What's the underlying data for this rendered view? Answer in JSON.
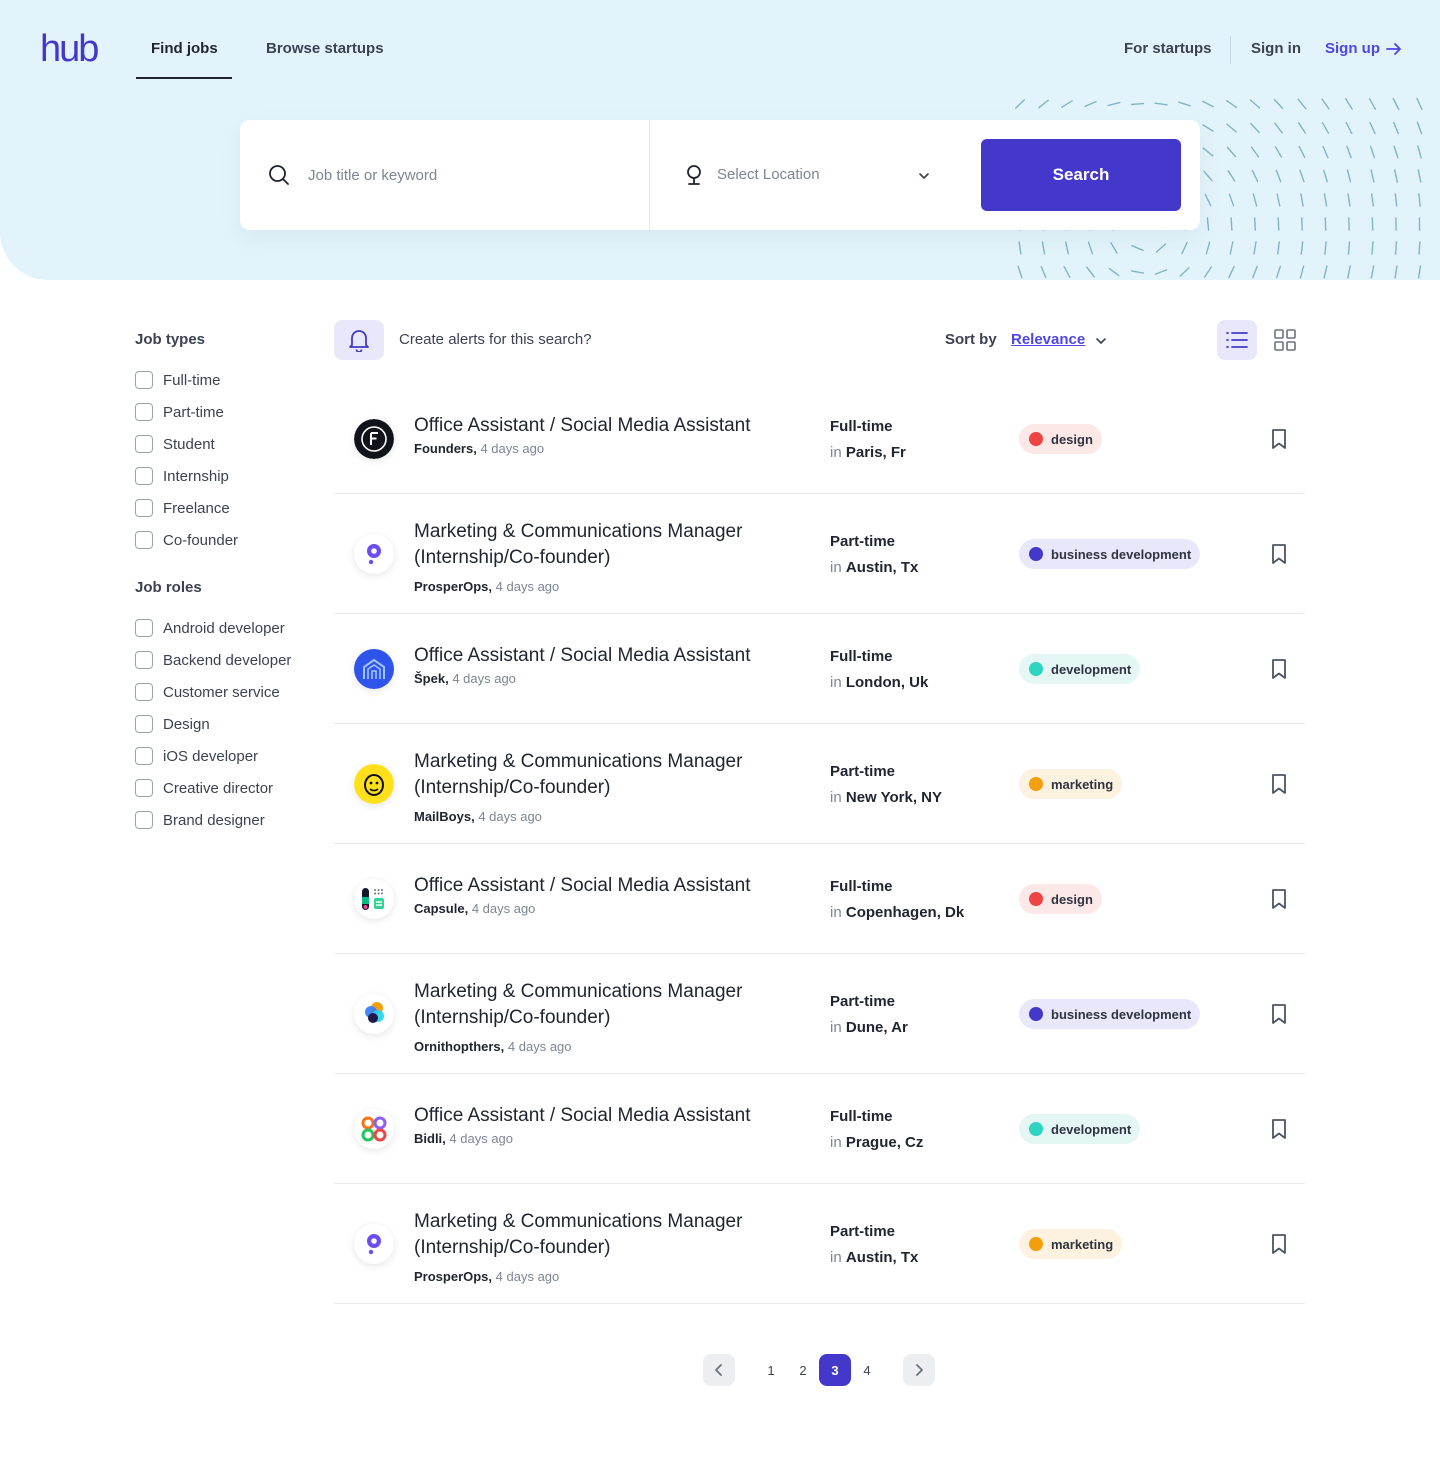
{
  "brand": {
    "logo_text": "hub",
    "accent_color": "#4338ca"
  },
  "nav": {
    "find_jobs": "Find jobs",
    "browse_startups": "Browse startups",
    "for_startups": "For startups",
    "sign_in": "Sign in",
    "sign_up": "Sign up"
  },
  "search": {
    "keyword_placeholder": "Job title or keyword",
    "location_placeholder": "Select Location",
    "button_label": "Search"
  },
  "filters": {
    "job_types_heading": "Job types",
    "job_types": [
      "Full-time",
      "Part-time",
      "Student",
      "Internship",
      "Freelance",
      "Co-founder"
    ],
    "job_roles_heading": "Job roles",
    "job_roles": [
      "Android developer",
      "Backend developer",
      "Customer service",
      "Design",
      "iOS developer",
      "Creative director",
      "Brand designer"
    ]
  },
  "toolbar": {
    "alert_text": "Create alerts for this search?",
    "sort_label": "Sort by",
    "sort_value": "Relevance"
  },
  "tag_colors": {
    "design": {
      "dot": "#ef4444",
      "bg": "#fde8e8"
    },
    "business development": {
      "dot": "#4338ca",
      "bg": "#e9e8fb"
    },
    "development": {
      "dot": "#2dd4bf",
      "bg": "#e4f7f5"
    },
    "marketing": {
      "dot": "#f59e0b",
      "bg": "#fdf1df"
    }
  },
  "jobs": [
    {
      "title": "Office Assistant / Social Media Assistant",
      "company": "Founders,",
      "posted": "4 days ago",
      "type": "Full-time",
      "location": "Paris, Fr",
      "tag": "design",
      "logo_icon": "founders-logo-icon"
    },
    {
      "title": "Marketing & Communications Manager (Internship/Co-founder)",
      "company": "ProsperOps,",
      "posted": "4 days ago",
      "type": "Part-time",
      "location": "Austin, Tx",
      "tag": "business development",
      "logo_icon": "prosperops-logo-icon"
    },
    {
      "title": "Office Assistant / Social Media Assistant",
      "company": "Špek,",
      "posted": "4 days ago",
      "type": "Full-time",
      "location": "London, Uk",
      "tag": "development",
      "logo_icon": "spek-logo-icon"
    },
    {
      "title": "Marketing & Communications Manager (Internship/Co-founder)",
      "company": "MailBoys,",
      "posted": "4 days ago",
      "type": "Part-time",
      "location": "New York, NY",
      "tag": "marketing",
      "logo_icon": "mailboys-logo-icon"
    },
    {
      "title": "Office Assistant / Social Media Assistant",
      "company": "Capsule,",
      "posted": "4 days ago",
      "type": "Full-time",
      "location": "Copenhagen, Dk",
      "tag": "design",
      "logo_icon": "capsule-logo-icon"
    },
    {
      "title": "Marketing & Communications Manager (Internship/Co-founder)",
      "company": "Ornithopthers,",
      "posted": "4 days ago",
      "type": "Part-time",
      "location": "Dune, Ar",
      "tag": "business development",
      "logo_icon": "ornithopthers-logo-icon"
    },
    {
      "title": "Office Assistant / Social Media Assistant",
      "company": "Bidli,",
      "posted": "4 days ago",
      "type": "Full-time",
      "location": "Prague, Cz",
      "tag": "development",
      "logo_icon": "bidli-logo-icon"
    },
    {
      "title": "Marketing & Communications Manager (Internship/Co-founder)",
      "company": "ProsperOps,",
      "posted": "4 days ago",
      "type": "Part-time",
      "location": "Austin, Tx",
      "tag": "marketing",
      "logo_icon": "prosperops-logo-icon"
    }
  ],
  "location_prefix": "in",
  "pagination": {
    "pages": [
      "1",
      "2",
      "3",
      "4"
    ],
    "current": "3"
  }
}
